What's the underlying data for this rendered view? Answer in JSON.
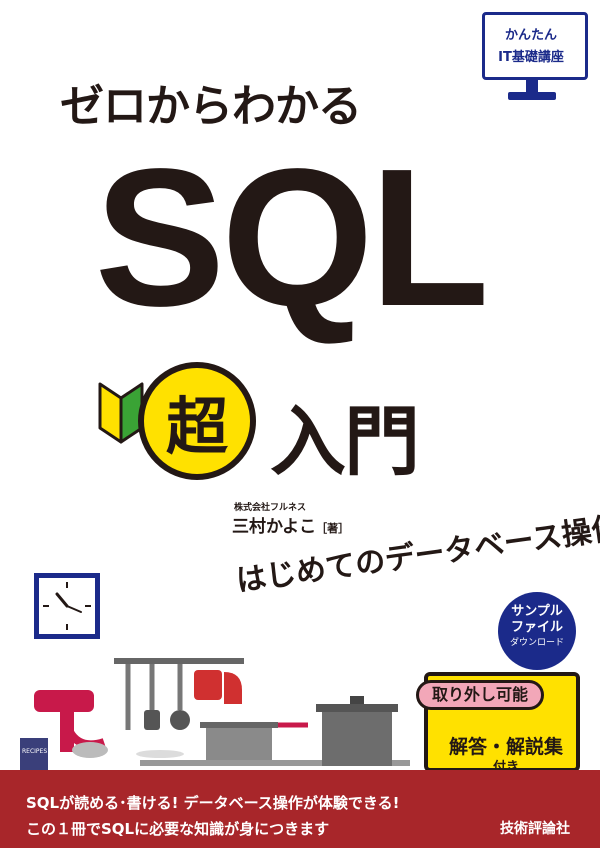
{
  "series_badge": {
    "line1": "かんたん",
    "line2": "IT基礎講座"
  },
  "cover": {
    "subtitle": "ゼロからわかる",
    "main_title": "SQL",
    "super_char": "超",
    "intro": "入門",
    "author_affiliation": "株式会社フルネス",
    "author_name": "三村かよこ",
    "author_role": "［著］",
    "tagline": "はじめてのデータベース操作"
  },
  "sample_badge": {
    "line1": "サンプル",
    "line2": "ファイル",
    "line3": "ダウンロード"
  },
  "kitchen": {
    "recipes_label": "RECIPES"
  },
  "answer_book": {
    "label": "取り外し可能",
    "title": "解答・解説集",
    "subtitle": "付き"
  },
  "bottom_band": {
    "line1": "SQLが読める･書ける! データベース操作が体験できる!",
    "line2": "この１冊でSQLに必要な知識が身につきます",
    "publisher": "技術評論社"
  },
  "colors": {
    "navy": "#1b2a8a",
    "yellow": "#ffe100",
    "band_red": "#a8262a",
    "text_black": "#231815",
    "pink": "#f2a7b8",
    "mixer_red": "#c8194a"
  }
}
